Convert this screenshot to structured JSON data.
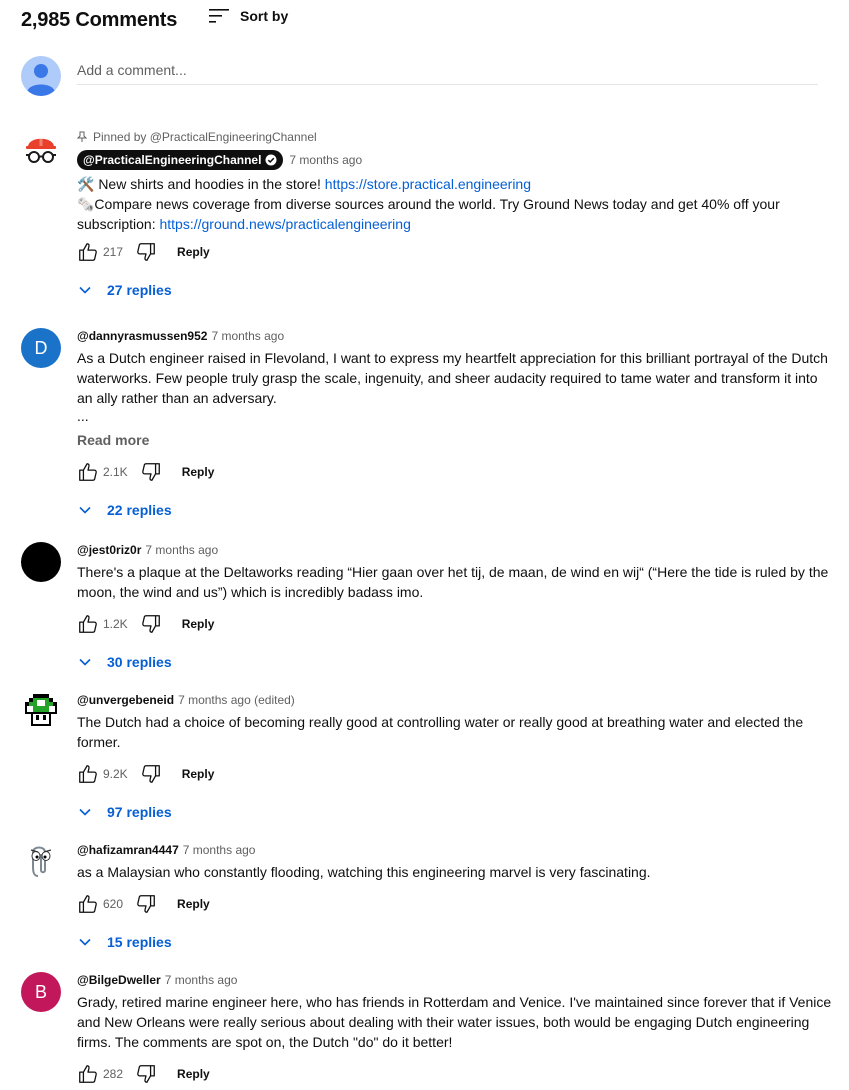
{
  "header": {
    "count": "2,985 Comments",
    "sort_label": "Sort by"
  },
  "add_comment": {
    "placeholder": "Add a comment..."
  },
  "comments": [
    {
      "pinned_by": "Pinned by @PracticalEngineeringChannel",
      "author": "@PracticalEngineeringChannel",
      "time": "7 months ago",
      "line1_prefix": "🛠️ New shirts and hoodies in the store! ",
      "line1_link": "https://store.practical.engineering",
      "line2": "🗞️Compare news coverage from diverse sources around the world. Try Ground News today and get 40% off your subscription: ",
      "line2_link": "https://ground.news/practicalengineering",
      "likes": "217",
      "reply": "Reply",
      "replies": "27 replies"
    },
    {
      "avatar_letter": "D",
      "author": "@dannyrasmussen952",
      "time": "7 months ago",
      "text": "As a Dutch engineer raised in Flevoland, I want to express my heartfelt appreciation for this brilliant portrayal of the Dutch waterworks. Few people truly grasp the scale, ingenuity, and sheer audacity required to tame water and transform it into an ally rather than an adversary.",
      "ellipsis": "...",
      "read_more": "Read more",
      "likes": "2.1K",
      "reply": "Reply",
      "replies": "22 replies"
    },
    {
      "author": "@jest0riz0r",
      "time": "7 months ago",
      "text": "There's a plaque at the Deltaworks reading “Hier gaan over het tij, de maan, de wind en wij“ (“Here the tide is ruled by the moon, the wind and us”) which is incredibly badass imo.",
      "likes": "1.2K",
      "reply": "Reply",
      "replies": "30 replies"
    },
    {
      "author": "@unvergebeneid",
      "time": "7 months ago (edited)",
      "text": "The Dutch had a choice of becoming really good at controlling water or really good at breathing water and elected the former.",
      "likes": "9.2K",
      "reply": "Reply",
      "replies": "97 replies"
    },
    {
      "author": "@hafizamran4447",
      "time": "7 months ago",
      "text": "as a Malaysian who constantly flooding, watching this engineering marvel is very fascinating.",
      "likes": "620",
      "reply": "Reply",
      "replies": "15 replies"
    },
    {
      "avatar_letter": "B",
      "author": "@BilgeDweller",
      "time": "7 months ago",
      "text": "Grady, retired marine engineer here, who has friends in Rotterdam and Venice. I've maintained since forever that if Venice and New Orleans were really serious about dealing with their water issues, both would be engaging Dutch engineering firms. The comments are spot on, the Dutch \"do\" do it better!",
      "likes": "282",
      "reply": "Reply"
    }
  ],
  "colors": {
    "link": "#065fd4",
    "avatar_d": "#1a73c8",
    "avatar_b": "#c2185b",
    "frog_green": "#23a427"
  }
}
